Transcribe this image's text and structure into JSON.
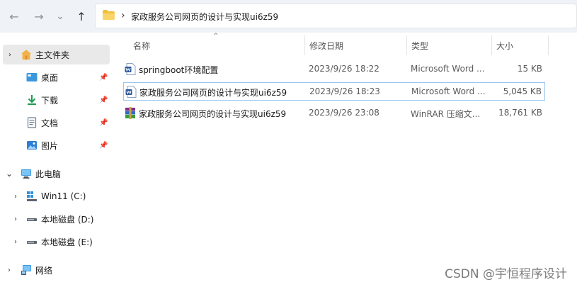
{
  "nav": {
    "back_icon": "←",
    "forward_icon": "→",
    "recent_icon": "⌄",
    "up_icon": "↑"
  },
  "address": {
    "separator": "›",
    "path": "家政服务公司网页的设计与实现ui6z59"
  },
  "sidebar": {
    "items": [
      {
        "label": "主文件夹",
        "chevron": "›",
        "icon": "home-icon"
      },
      {
        "label": "桌面",
        "icon": "desktop-icon",
        "pin": "📌"
      },
      {
        "label": "下载",
        "icon": "download-icon",
        "pin": "📌"
      },
      {
        "label": "文档",
        "icon": "document-icon",
        "pin": "📌"
      },
      {
        "label": "图片",
        "icon": "pictures-icon",
        "pin": "📌"
      },
      {
        "label": "此电脑",
        "chevron": "⌄",
        "icon": "pc-icon"
      },
      {
        "label": "Win11 (C:)",
        "chevron": "›",
        "icon": "windows-drive-icon"
      },
      {
        "label": "本地磁盘 (D:)",
        "chevron": "›",
        "icon": "drive-icon"
      },
      {
        "label": "本地磁盘 (E:)",
        "chevron": "›",
        "icon": "drive-icon"
      },
      {
        "label": "网络",
        "chevron": "›",
        "icon": "network-icon"
      }
    ]
  },
  "columns": {
    "name": "名称",
    "date": "修改日期",
    "type": "类型",
    "size": "大小",
    "sort_arrow": "^"
  },
  "files": [
    {
      "name": "springboot环境配置",
      "date": "2023/9/26 18:22",
      "type": "Microsoft Word ...",
      "size": "15 KB",
      "icon": "word-icon"
    },
    {
      "name": "家政服务公司网页的设计与实现ui6z59",
      "date": "2023/9/26 18:23",
      "type": "Microsoft Word ...",
      "size": "5,045 KB",
      "icon": "word-icon"
    },
    {
      "name": "家政服务公司网页的设计与实现ui6z59",
      "date": "2023/9/26 23:08",
      "type": "WinRAR 压缩文...",
      "size": "18,761 KB",
      "icon": "winrar-icon"
    }
  ],
  "watermark": "CSDN @宇恒程序设计",
  "colors": {
    "folder": "#f3c03c",
    "accent": "#0078d4",
    "word": "#2b579a"
  }
}
